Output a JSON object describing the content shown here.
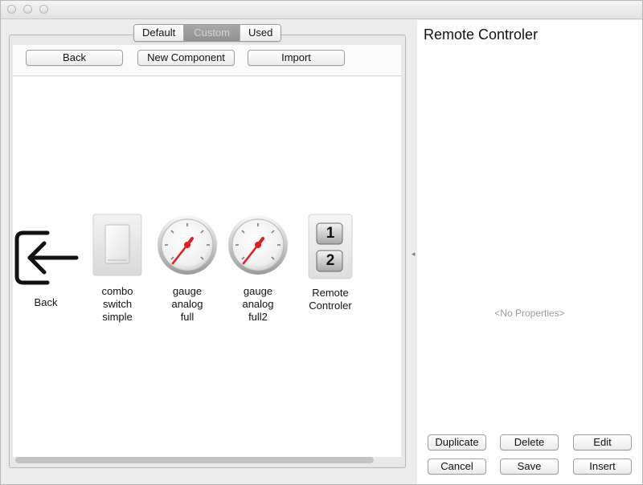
{
  "window": {
    "title_buttons": [
      "close-button",
      "minimize-button",
      "zoom-button"
    ]
  },
  "tabs": [
    {
      "label": "Default",
      "active": false
    },
    {
      "label": "Custom",
      "active": true
    },
    {
      "label": "Used",
      "active": false
    }
  ],
  "toolbar": {
    "back_label": "Back",
    "new_component_label": "New Component",
    "import_label": "Import"
  },
  "components": [
    {
      "label": "Back",
      "icon": "back-arrow-icon"
    },
    {
      "label": "combo\nswitch\nsimple",
      "icon": "switch-icon"
    },
    {
      "label": "gauge\nanalog\nfull",
      "icon": "gauge-icon"
    },
    {
      "label": "gauge\nanalog\nfull2",
      "icon": "gauge-icon"
    },
    {
      "label": "Remote\nControler",
      "icon": "remote-controller-icon",
      "keys": [
        "1",
        "2"
      ]
    }
  ],
  "properties": {
    "title": "Remote Controler",
    "empty_text": "<No Properties>"
  },
  "actions": {
    "duplicate_label": "Duplicate",
    "delete_label": "Delete",
    "edit_label": "Edit",
    "cancel_label": "Cancel",
    "save_label": "Save",
    "insert_label": "Insert"
  },
  "colors": {
    "needle": "#e01d1d",
    "active_tab": "#9a9a9a",
    "background": "#ececec"
  }
}
